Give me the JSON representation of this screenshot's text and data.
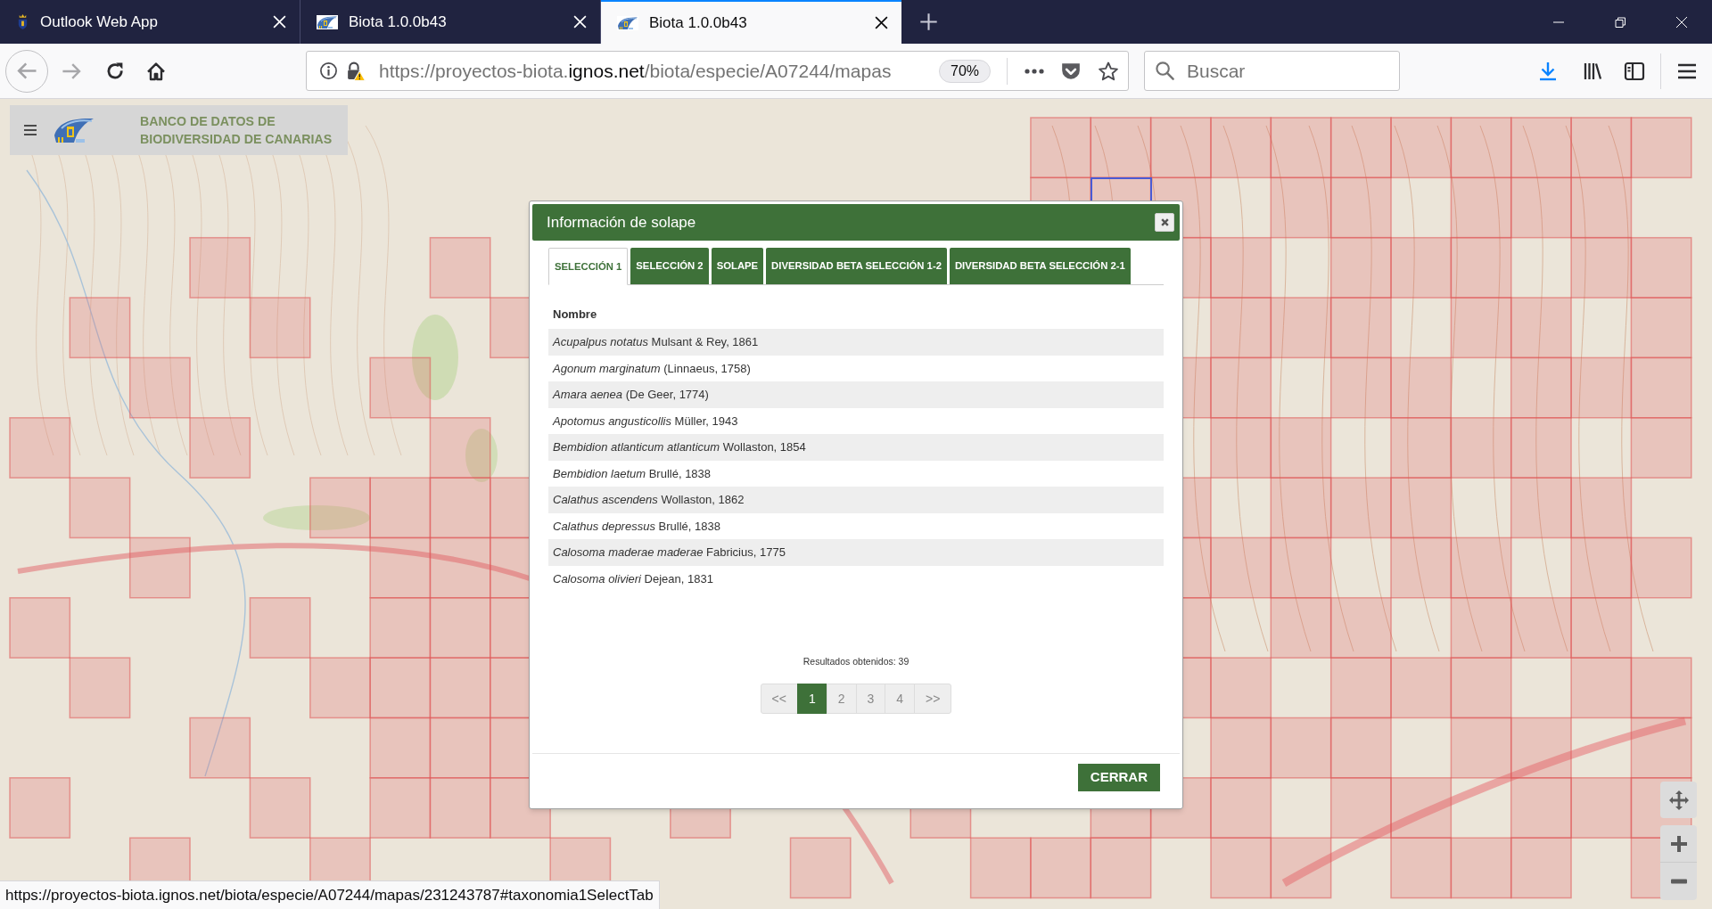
{
  "browser": {
    "tabs": [
      {
        "title": "Outlook Web App",
        "selected": false,
        "kind": "crest"
      },
      {
        "title": "Biota 1.0.0b43",
        "selected": false,
        "kind": "logo"
      },
      {
        "title": "Biota 1.0.0b43",
        "selected": true,
        "kind": "logo"
      }
    ],
    "address_bar": {
      "url": {
        "prefix": "https://proyectos-biota.",
        "domain": "ignos.net",
        "path": "/biota/especie/A07244/mapas"
      },
      "zoom": "70%"
    },
    "search": {
      "placeholder": "Buscar"
    }
  },
  "site_header": {
    "title": "BANCO DE DATOS DE BIODIVERSIDAD DE CANARIAS"
  },
  "dialog": {
    "title": "Información de solape",
    "tabs": [
      {
        "label": "SELECCIÓN 1",
        "selected": true
      },
      {
        "label": "SELECCIÓN 2",
        "selected": false
      },
      {
        "label": "SOLAPE",
        "selected": false
      },
      {
        "label": "DIVERSIDAD BETA SELECCIÓN 1-2",
        "selected": false
      },
      {
        "label": "DIVERSIDAD BETA SELECCIÓN 2-1",
        "selected": false
      }
    ],
    "table": {
      "columns": [
        "Nombre"
      ],
      "rows": [
        "*Acupalpus notatus* Mulsant & Rey, 1861",
        "*Agonum marginatum* (Linnaeus, 1758)",
        "*Amara aenea* (De Geer, 1774)",
        "*Apotomus angusticollis* Müller, 1943",
        "*Bembidion atlanticum atlanticum* Wollaston, 1854",
        "*Bembidion laetum* Brullé, 1838",
        "*Calathus ascendens* Wollaston, 1862",
        "*Calathus depressus* Brullé, 1838",
        "*Calosoma maderae maderae* Fabricius, 1775",
        "*Calosoma olivieri* Dejean, 1831"
      ]
    },
    "results": "Resultados obtenidos: 39",
    "pagination": [
      {
        "label": "<<",
        "selected": false
      },
      {
        "label": "1",
        "selected": true
      },
      {
        "label": "2",
        "selected": false
      },
      {
        "label": "3",
        "selected": false
      },
      {
        "label": "4",
        "selected": false
      },
      {
        "label": ">>",
        "selected": false
      }
    ],
    "buttons": [
      "CERRAR"
    ]
  },
  "status_bar": {
    "url": "https://proyectos-biota.ignos.net/biota/especie/A07244/mapas/231243787#taxonomia1SelectTab"
  }
}
